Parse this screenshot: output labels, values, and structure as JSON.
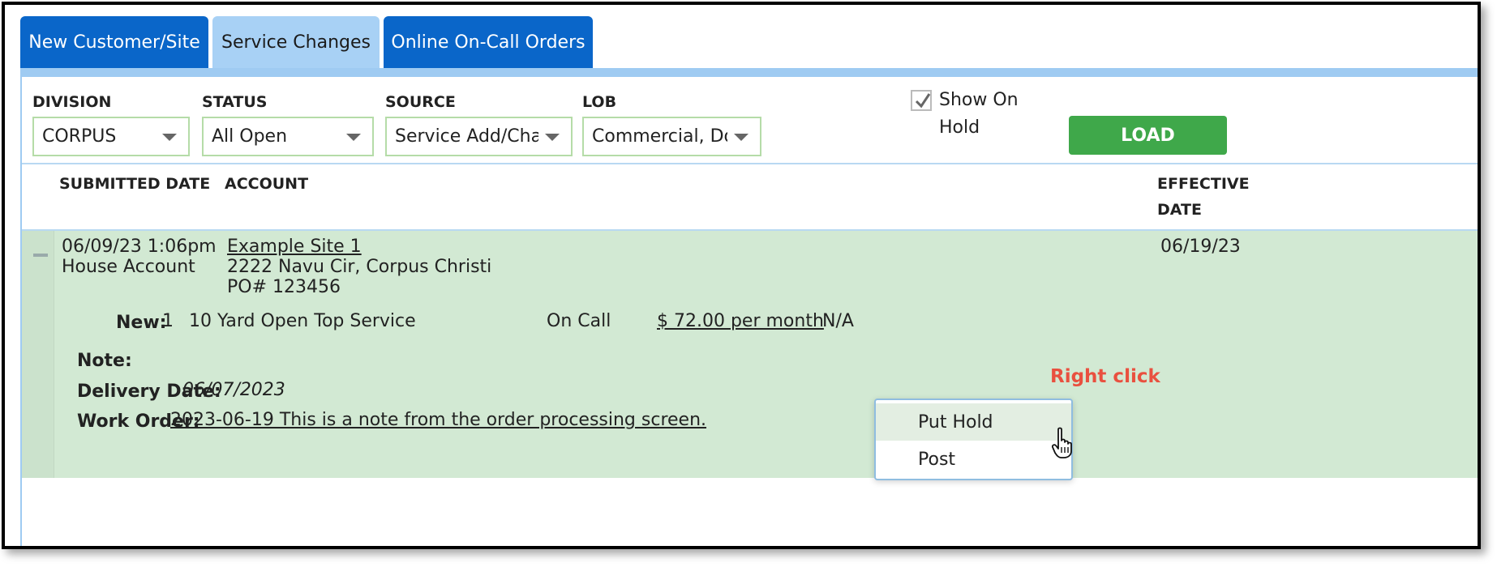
{
  "tabs": [
    {
      "label": "New Customer/Site",
      "active": false
    },
    {
      "label": "Service Changes",
      "active": true
    },
    {
      "label": "Online On-Call Orders",
      "active": false
    }
  ],
  "filters": {
    "division": {
      "label": "DIVISION",
      "value": "CORPUS"
    },
    "status": {
      "label": "STATUS",
      "value": "All Open"
    },
    "source": {
      "label": "SOURCE",
      "value": "Service Add/Change,"
    },
    "lob": {
      "label": "LOB",
      "value": "Commercial, Docun"
    },
    "show_on_hold": {
      "label": "Show On Hold",
      "checked": true
    },
    "load_button": "LOAD"
  },
  "table": {
    "headers": {
      "submitted_date": "SUBMITTED DATE",
      "account": "ACCOUNT",
      "effective_date": "EFFECTIVE DATE"
    },
    "row": {
      "submitted": "06/09/23 1:06pm",
      "account_type": "House Account",
      "site_name": "Example Site 1",
      "address": "2222 Navu Cir, Corpus Christi",
      "po": "PO# 123456",
      "effective_date": "06/19/23",
      "service": {
        "label": "New:",
        "qty": "1",
        "description": "10 Yard Open Top Service",
        "frequency": "On Call",
        "price": "$ 72.00 per month",
        "extra": "N/A"
      },
      "note_label": "Note:",
      "note_value": "",
      "delivery_label": "Delivery Date:",
      "delivery_value": "06/07/2023",
      "work_order_label": "Work Order:",
      "work_order_value": "2023-06-19 This is a note from the order processing screen."
    }
  },
  "context_menu": {
    "items": [
      "Put Hold",
      "Post"
    ],
    "hovered_index": 0
  },
  "annotation": "Right click",
  "colors": {
    "tab_blue": "#0a66c9",
    "tab_active": "#a8d1f5",
    "load_green": "#3fa84a",
    "row_bg": "#d2e9d3",
    "annotation_red": "#e9503f"
  }
}
